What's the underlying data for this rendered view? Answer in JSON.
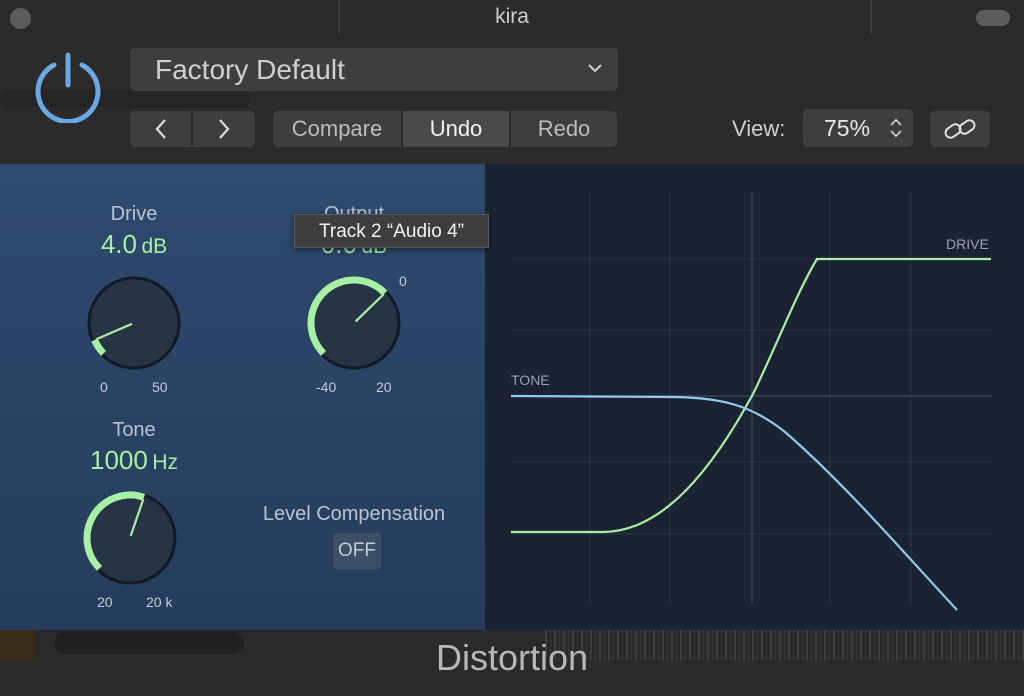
{
  "window": {
    "title": "kira"
  },
  "header": {
    "preset_name": "Factory Default",
    "prev_icon": "chevron-left-icon",
    "next_icon": "chevron-right-icon",
    "compare_label": "Compare",
    "undo_label": "Undo",
    "redo_label": "Redo",
    "view_label": "View:",
    "view_value": "75%",
    "link_icon": "link-icon"
  },
  "controls": {
    "drive": {
      "title": "Drive",
      "value": "4.0",
      "unit": "dB",
      "min": "0",
      "max": "50",
      "fraction": 0.08
    },
    "output": {
      "title": "Output",
      "value": "0.0",
      "unit": "dB",
      "min": "-40",
      "max": "20",
      "zero_label": "0",
      "fraction": 0.67
    },
    "tone": {
      "title": "Tone",
      "value": "1000",
      "unit": "Hz",
      "min": "20",
      "max": "20 k",
      "fraction": 0.57
    },
    "level_compensation": {
      "label": "Level Compensation",
      "state": "OFF"
    }
  },
  "tooltip": {
    "text": "Track 2 “Audio 4”"
  },
  "graph": {
    "drive_label": "DRIVE",
    "tone_label": "TONE"
  },
  "colors": {
    "accent_green": "#a8f0a4",
    "tone_blue": "#8ecbef",
    "panel_blue": "#2b4566"
  },
  "plugin": {
    "name": "Distortion"
  }
}
